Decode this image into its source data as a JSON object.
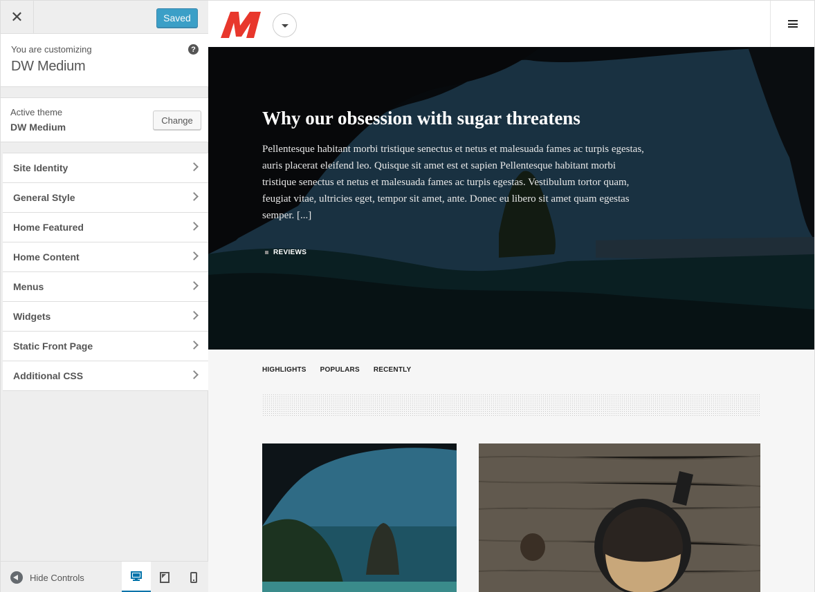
{
  "customizer": {
    "close_symbol": "✕",
    "save_label": "Saved",
    "customizing_prefix": "You are customizing",
    "customizing_title": "DW Medium",
    "help_symbol": "?",
    "active_theme_label": "Active theme",
    "active_theme_name": "DW Medium",
    "change_label": "Change",
    "panels": [
      {
        "label": "Site Identity"
      },
      {
        "label": "General Style"
      },
      {
        "label": "Home Featured"
      },
      {
        "label": "Home Content"
      },
      {
        "label": "Menus"
      },
      {
        "label": "Widgets"
      },
      {
        "label": "Static Front Page"
      },
      {
        "label": "Additional CSS"
      }
    ],
    "hide_controls_label": "Hide Controls",
    "devices": [
      "desktop",
      "tablet",
      "mobile"
    ],
    "active_device": "desktop"
  },
  "preview": {
    "hero": {
      "title": "Why our obsession with sugar threatens",
      "excerpt": "Pellentesque habitant morbi tristique senectus et netus et malesuada fames ac turpis egestas, auris placerat eleifend leo. Quisque sit amet est et sapien Pellentesque habitant morbi tristique senectus et netus et malesuada fames ac turpis egestas. Vestibulum tortor quam, feugiat vitae, ultricies eget, tempor sit amet, ante. Donec eu libero sit amet quam egestas semper. [...]",
      "category": "REVIEWS"
    },
    "tabs": [
      "HIGHLIGHTS",
      "POPULARS",
      "RECENTLY"
    ]
  },
  "colors": {
    "accent": "#0085ba",
    "logo": "#e8372c",
    "sidebar_bg": "#eeeeee",
    "preview_bg": "#f6f6f6"
  },
  "icons": {
    "close": "close-icon",
    "help": "help-icon",
    "chevron": "chevron-right-icon",
    "hide": "hide-controls-icon",
    "menu": "hamburger-menu-icon",
    "dropdown": "caret-down-icon"
  }
}
